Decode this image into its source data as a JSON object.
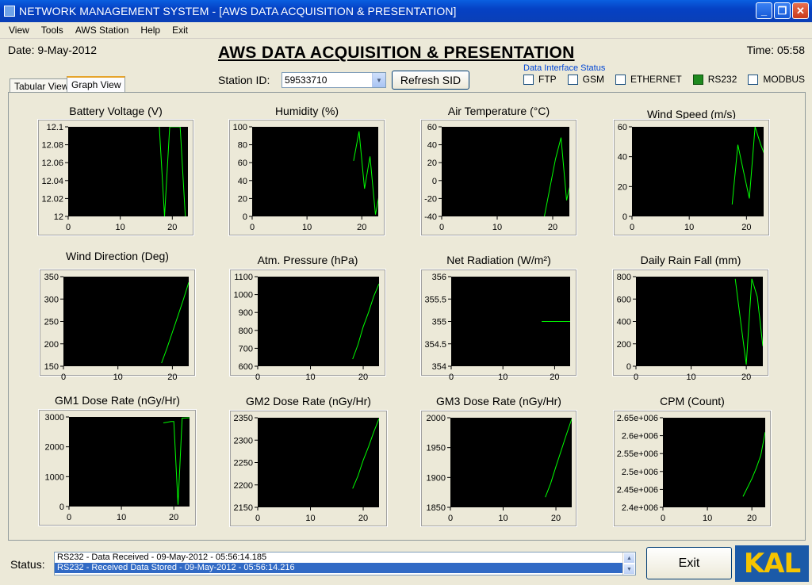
{
  "window": {
    "title": "NETWORK MANAGEMENT SYSTEM - [AWS DATA ACQUISITION & PRESENTATION]",
    "minimize": "_",
    "restore": "❐",
    "close": "✕"
  },
  "menu": [
    "View",
    "Tools",
    "AWS Station",
    "Help",
    "Exit"
  ],
  "header": {
    "date": "Date: 9-May-2012",
    "heading": "AWS DATA ACQUISITION & PRESENTATION",
    "time": "Time: 05:58",
    "station_label": "Station ID:",
    "station_id": "59533710",
    "refresh_label": "Refresh SID"
  },
  "interface_status": {
    "caption": "Data Interface Status",
    "items": [
      {
        "label": "FTP",
        "checked": false
      },
      {
        "label": "GSM",
        "checked": false
      },
      {
        "label": "ETHERNET",
        "checked": false
      },
      {
        "label": "RS232",
        "checked": true
      },
      {
        "label": "MODBUS",
        "checked": false
      }
    ]
  },
  "tabs": {
    "tabular": "Tabular View",
    "graph": "Graph View"
  },
  "colors": {
    "plot_bg": "#000000",
    "line": "#00ff00",
    "active_iface": "#1f8a1f"
  },
  "chart_data": [
    {
      "type": "line",
      "title": "Battery Voltage (V)",
      "xlim": [
        0,
        23
      ],
      "ylim": [
        12,
        12.1
      ],
      "xticks": [
        0,
        10,
        20
      ],
      "yticks": [
        "12.1",
        "12.08",
        "12.06",
        "12.04",
        "12.02",
        "12"
      ],
      "series": [
        {
          "x": [
            17.5,
            18.5,
            19.5,
            20.5,
            21.5,
            22.5
          ],
          "y": [
            12.1,
            12.0,
            12.1,
            12.1,
            12.1,
            12.0
          ]
        }
      ]
    },
    {
      "type": "line",
      "title": "Humidity (%)",
      "xlim": [
        0,
        23
      ],
      "ylim": [
        0,
        100
      ],
      "xticks": [
        0,
        10,
        20
      ],
      "yticks": [
        "100",
        "80",
        "60",
        "40",
        "20",
        "0"
      ],
      "series": [
        {
          "x": [
            18.5,
            19.5,
            20.5,
            21.5,
            22.5,
            23.5
          ],
          "y": [
            62,
            95,
            31,
            67,
            2,
            35
          ]
        }
      ]
    },
    {
      "type": "line",
      "title": "Air Temperature (°C)",
      "xlim": [
        0,
        23
      ],
      "ylim": [
        -40,
        60
      ],
      "xticks": [
        0,
        10,
        20
      ],
      "yticks": [
        "60",
        "40",
        "20",
        "0",
        "-20",
        "-40"
      ],
      "series": [
        {
          "x": [
            18.5,
            19.5,
            20.5,
            21.5,
            22.5,
            23.5
          ],
          "y": [
            -40,
            -8,
            24,
            48,
            -22,
            4
          ]
        }
      ]
    },
    {
      "type": "line",
      "title": "Wind Speed (m/s)",
      "xlim": [
        0,
        23
      ],
      "ylim": [
        0,
        60
      ],
      "xticks": [
        0,
        10,
        20
      ],
      "yticks": [
        "60",
        "40",
        "20",
        "0"
      ],
      "series": [
        {
          "x": [
            17.5,
            18.5,
            19.5,
            20.5,
            21.5,
            22.5,
            23.5
          ],
          "y": [
            8,
            48,
            30,
            12,
            60,
            48,
            38
          ]
        }
      ]
    },
    {
      "type": "line",
      "title": "Wind Direction (Deg)",
      "xlim": [
        0,
        23
      ],
      "ylim": [
        150,
        350
      ],
      "xticks": [
        0,
        10,
        20
      ],
      "yticks": [
        "350",
        "300",
        "250",
        "200",
        "150"
      ],
      "series": [
        {
          "x": [
            18,
            19,
            20,
            21,
            22,
            23
          ],
          "y": [
            157,
            190,
            226,
            262,
            298,
            337
          ]
        }
      ]
    },
    {
      "type": "line",
      "title": "Atm. Pressure (hPa)",
      "xlim": [
        0,
        23
      ],
      "ylim": [
        600,
        1100
      ],
      "xticks": [
        0,
        10,
        20
      ],
      "yticks": [
        "1100",
        "1000",
        "900",
        "800",
        "700",
        "600"
      ],
      "series": [
        {
          "x": [
            18,
            19,
            20,
            21,
            22,
            23
          ],
          "y": [
            640,
            720,
            820,
            900,
            990,
            1060
          ]
        }
      ]
    },
    {
      "type": "line",
      "title": "Net Radiation (W/m²)",
      "xlim": [
        0,
        23
      ],
      "ylim": [
        354,
        356
      ],
      "xticks": [
        0,
        10,
        20
      ],
      "yticks": [
        "356",
        "355.5",
        "355",
        "354.5",
        "354"
      ],
      "series": [
        {
          "x": [
            17.5,
            23.5
          ],
          "y": [
            355,
            355
          ]
        }
      ]
    },
    {
      "type": "line",
      "title": "Daily Rain Fall (mm)",
      "xlim": [
        0,
        23
      ],
      "ylim": [
        0,
        800
      ],
      "xticks": [
        0,
        10,
        20
      ],
      "yticks": [
        "800",
        "600",
        "400",
        "200",
        "0"
      ],
      "series": [
        {
          "x": [
            18,
            19,
            20,
            21,
            22,
            23
          ],
          "y": [
            780,
            390,
            15,
            780,
            620,
            180
          ]
        }
      ]
    },
    {
      "type": "line",
      "title": "GM1 Dose Rate  (nGy/Hr)",
      "xlim": [
        0,
        23
      ],
      "ylim": [
        0,
        3000
      ],
      "xticks": [
        0,
        10,
        20
      ],
      "yticks": [
        "3000",
        "2000",
        "1000",
        "0"
      ],
      "series": [
        {
          "x": [
            18,
            19.5,
            20,
            20.8,
            21.6,
            23.5
          ],
          "y": [
            2800,
            2850,
            2850,
            60,
            2960,
            2980
          ]
        }
      ]
    },
    {
      "type": "line",
      "title": "GM2 Dose Rate  (nGy/Hr)",
      "xlim": [
        0,
        23
      ],
      "ylim": [
        2150,
        2350
      ],
      "xticks": [
        0,
        10,
        20
      ],
      "yticks": [
        "2350",
        "2300",
        "2250",
        "2200",
        "2150"
      ],
      "series": [
        {
          "x": [
            18,
            19,
            20,
            21,
            22,
            23
          ],
          "y": [
            2192,
            2220,
            2255,
            2285,
            2318,
            2348
          ]
        }
      ]
    },
    {
      "type": "line",
      "title": "GM3 Dose Rate  (nGy/Hr)",
      "xlim": [
        0,
        23
      ],
      "ylim": [
        1850,
        2000
      ],
      "xticks": [
        0,
        10,
        20
      ],
      "yticks": [
        "2000",
        "1950",
        "1900",
        "1850"
      ],
      "series": [
        {
          "x": [
            18,
            19,
            20,
            21,
            22,
            23
          ],
          "y": [
            1867,
            1890,
            1918,
            1945,
            1972,
            1998
          ]
        }
      ]
    },
    {
      "type": "line",
      "title": "CPM (Count)",
      "xlim": [
        0,
        23
      ],
      "ylim": [
        2400000,
        2650000
      ],
      "xticks": [
        0,
        10,
        20
      ],
      "yticks": [
        "2.65e+006",
        "2.6e+006",
        "2.55e+006",
        "2.5e+006",
        "2.45e+006",
        "2.4e+006"
      ],
      "series": [
        {
          "x": [
            18,
            19,
            20,
            21,
            22,
            23
          ],
          "y": [
            2430000,
            2455000,
            2480000,
            2510000,
            2545000,
            2610000
          ]
        }
      ]
    }
  ],
  "status": {
    "label": "Status:",
    "lines": [
      "RS232 - Data Received - 09-May-2012 - 05:56:14.185",
      "RS232 - Received Data Stored - 09-May-2012 - 05:56:14.216"
    ]
  },
  "exit_label": "Exit",
  "logo_text": "KAL"
}
